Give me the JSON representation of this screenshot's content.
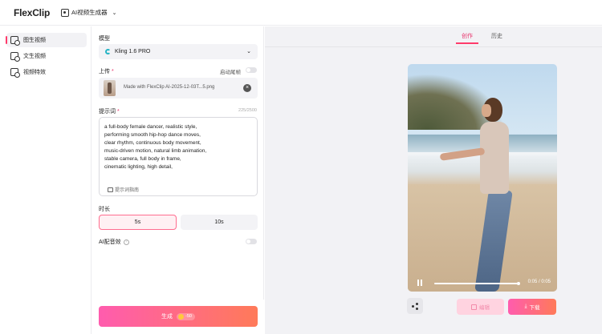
{
  "brand": {
    "logo_main": "Flex",
    "logo_clip": "Clip"
  },
  "header": {
    "tool_label": "AI视频生成器"
  },
  "sidebar": {
    "items": [
      {
        "label": "图生视频",
        "active": true
      },
      {
        "label": "文生视频",
        "active": false
      },
      {
        "label": "视频特效",
        "active": false
      }
    ]
  },
  "form": {
    "model_label": "模型",
    "model_value": "Kling 1.6 PRO",
    "upload_label": "上传",
    "required_mark": "*",
    "last_frame_label": "启动尾帧",
    "upload_filename": "Made with FlexClip AI-2025-12-03T...5.png",
    "prompt_label": "提示词",
    "prompt_count": "225/2500",
    "prompt_text": "a full-body female dancer, realistic style,\nperforming smooth hip-hop dance moves,\nclear rhythm, continuous body movement,\nmusic-driven motion, natural limb animation,\nstable camera, full body in frame,\ncinematic lighting, high detail,",
    "prompt_guide": "提示词指南",
    "duration_label": "时长",
    "duration_options": [
      "5s",
      "10s"
    ],
    "duration_selected": "5s",
    "ai_audio_label": "AI配音效",
    "ai_audio_help": "?",
    "generate_label": "生成",
    "generate_cost": "-50"
  },
  "preview": {
    "tabs": [
      "创作",
      "历史"
    ],
    "active_tab": "创作",
    "video_time": "0:05 / 0:05",
    "edit_label": "编辑",
    "download_label": "下载"
  },
  "colors": {
    "accent": "#ff3b6b",
    "gradient_start": "#ff5cae",
    "gradient_end": "#ff7a59"
  },
  "icons": [
    "image-to-video-icon",
    "text-to-video-icon",
    "video-effects-icon",
    "share-icon",
    "edit-icon",
    "download-icon",
    "coin-icon",
    "pause-icon"
  ]
}
